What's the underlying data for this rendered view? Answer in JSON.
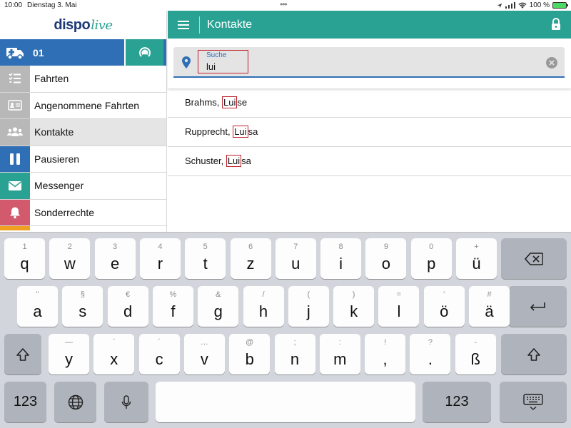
{
  "status_bar": {
    "time": "10:00",
    "date": "Dienstag 3. Mai",
    "battery": "100 %"
  },
  "sidebar": {
    "logo_main": "dispo",
    "logo_accent": "live",
    "vehicle_id": "01",
    "items": [
      {
        "label": "Fahrten",
        "icon": "list-icon",
        "color": "#b8b8b8"
      },
      {
        "label": "Angenommene Fahrten",
        "icon": "id-card-icon",
        "color": "#b8b8b8"
      },
      {
        "label": "Kontakte",
        "icon": "people-icon",
        "color": "#b8b8b8"
      },
      {
        "label": "Pausieren",
        "icon": "pause-icon",
        "color": "#2f6fb5"
      },
      {
        "label": "Messenger",
        "icon": "envelope-icon",
        "color": "#2aa293"
      },
      {
        "label": "Sonderrechte",
        "icon": "bell-icon",
        "color": "#d3596c"
      }
    ]
  },
  "topbar": {
    "title": "Kontakte"
  },
  "search": {
    "label": "Suche",
    "value": "lui"
  },
  "results": [
    {
      "prefix": "Brahms, ",
      "match": "Lui",
      "suffix": "se"
    },
    {
      "prefix": "Rupprecht, ",
      "match": "Lui",
      "suffix": "sa"
    },
    {
      "prefix": "Schuster, ",
      "match": "Lui",
      "suffix": "sa"
    }
  ],
  "keyboard": {
    "row1": [
      [
        "1",
        "q"
      ],
      [
        "2",
        "w"
      ],
      [
        "3",
        "e"
      ],
      [
        "4",
        "r"
      ],
      [
        "5",
        "t"
      ],
      [
        "6",
        "z"
      ],
      [
        "7",
        "u"
      ],
      [
        "8",
        "i"
      ],
      [
        "9",
        "o"
      ],
      [
        "0",
        "p"
      ],
      [
        "+",
        "ü"
      ]
    ],
    "row2": [
      [
        "\"",
        "a"
      ],
      [
        "§",
        "s"
      ],
      [
        "€",
        "d"
      ],
      [
        "%",
        "f"
      ],
      [
        "&",
        "g"
      ],
      [
        "/",
        "h"
      ],
      [
        "(",
        "j"
      ],
      [
        ")",
        "k"
      ],
      [
        "=",
        "l"
      ],
      [
        "'",
        "ö"
      ],
      [
        "#",
        "ä"
      ]
    ],
    "row3": [
      [
        "—",
        "y"
      ],
      [
        "`",
        "x"
      ],
      [
        "´",
        "c"
      ],
      [
        "…",
        "v"
      ],
      [
        "@",
        "b"
      ],
      [
        ";",
        "n"
      ],
      [
        ":",
        "m"
      ],
      [
        "!",
        ","
      ],
      [
        "?",
        "."
      ],
      [
        "-",
        "ß"
      ]
    ],
    "numbers_label": "123"
  },
  "colors": {
    "accent": "#2aa293",
    "brand_blue": "#2f6fb5",
    "highlight_red": "#c0202a"
  }
}
